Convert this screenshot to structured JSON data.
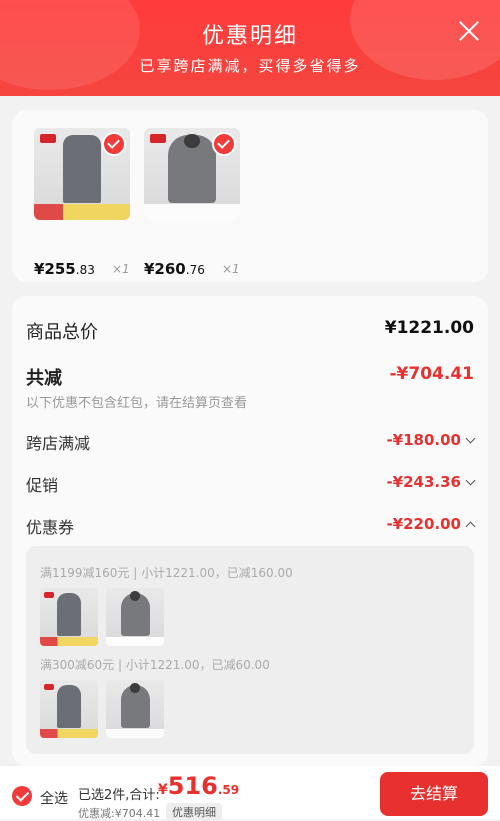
{
  "header": {
    "title": "优惠明细",
    "subtitle": "已享跨店满减，买得多省得多"
  },
  "products": [
    {
      "price_int": "¥255",
      "price_dec": ".83",
      "qty": "×1",
      "type": "jeans"
    },
    {
      "price_int": "¥260",
      "price_dec": ".76",
      "qty": "×1",
      "type": "jacket"
    }
  ],
  "detail": {
    "total_label": "商品总价",
    "total_value": "¥1221.00",
    "reduce_label": "共减",
    "reduce_value": "-¥704.41",
    "note": "以下优惠不包含红包，请在结算页查看",
    "items": [
      {
        "label": "跨店满减",
        "value": "-¥180.00"
      },
      {
        "label": "促销",
        "value": "-¥243.36"
      },
      {
        "label": "优惠券",
        "value": "-¥220.00"
      }
    ],
    "groups": [
      {
        "text": "满1199减160元 | 小计1221.00，已减160.00"
      },
      {
        "text": "满300减60元 | 小计1221.00，已减60.00"
      }
    ]
  },
  "bottom": {
    "select_all": "全选",
    "summary": "已选2件,合计:",
    "total_sym": "¥",
    "total_int": "516",
    "total_dec": ".59",
    "discount_line": "优惠减:¥704.41",
    "detail_pill": "优惠明细",
    "checkout": "去结算"
  },
  "colors": {
    "accent": "#e8312f",
    "header": "#f5453f"
  }
}
